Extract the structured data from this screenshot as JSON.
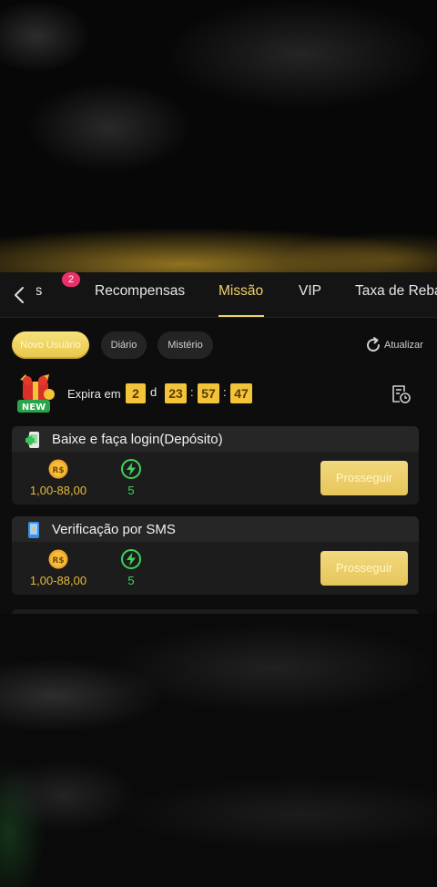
{
  "tabs": {
    "partial": "os",
    "partial_badge": "2",
    "items": [
      "Recompensas",
      "Missão",
      "VIP",
      "Taxa de Reba"
    ],
    "active": "Missão"
  },
  "filters": {
    "items": [
      "Novo Usuário",
      "Diário",
      "Mistério"
    ],
    "active": "Novo Usuário"
  },
  "refresh_label": "Atualizar",
  "countdown": {
    "label": "Expira em",
    "days": "2",
    "day_unit": "d",
    "hours": "23",
    "minutes": "57",
    "seconds": "47",
    "separator": ":"
  },
  "promo_badge": "NEW",
  "missions": [
    {
      "title": "Baixe e faça login(Depósito)",
      "currency_symbol": "R$",
      "money_reward": "1,00-88,00",
      "energy_reward": "5",
      "button": "Prosseguir"
    },
    {
      "title": "Verificação por SMS",
      "currency_symbol": "R$",
      "money_reward": "1,00-88,00",
      "energy_reward": "5",
      "button": "Prosseguir"
    }
  ],
  "colors": {
    "accent_gold": "#f1d16d",
    "countdown_bg": "#f3c43a",
    "badge_pink": "#e8306a",
    "energy_green": "#3fd25a"
  }
}
